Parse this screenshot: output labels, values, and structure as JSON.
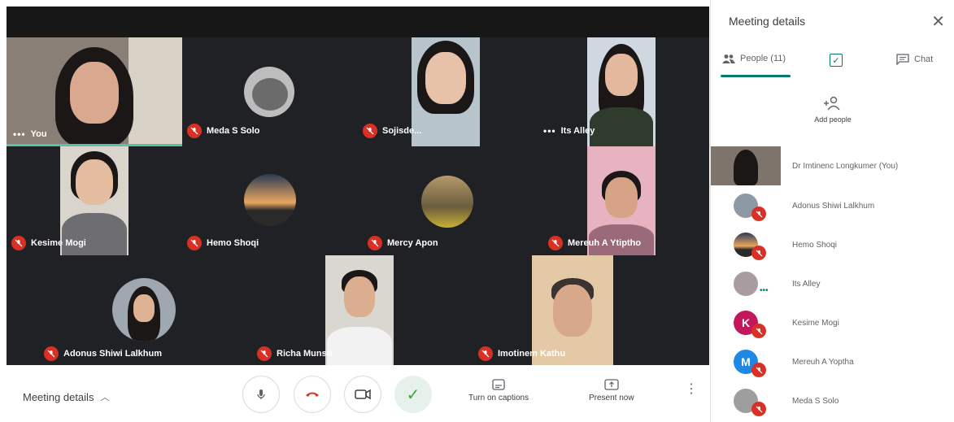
{
  "grid": {
    "tiles": [
      {
        "name": "You",
        "muted": false,
        "more": true
      },
      {
        "name": "Meda S Solo",
        "muted": true
      },
      {
        "name": "Sojisde...",
        "muted": true
      },
      {
        "name": "Its Alley",
        "muted": false,
        "more": true
      },
      {
        "name": "Kesime Mogi",
        "muted": true
      },
      {
        "name": "Hemo Shoqi",
        "muted": true
      },
      {
        "name": "Mercy Apon",
        "muted": true
      },
      {
        "name": "Mereuh A Ytiptho",
        "muted": true
      },
      {
        "name": "Adonus Shiwi Lalkhum",
        "muted": true
      },
      {
        "name": "Richa Munsti",
        "muted": true
      },
      {
        "name": "Imotinem Kathu",
        "muted": true
      }
    ]
  },
  "controls": {
    "meeting_details": "Meeting details",
    "captions": "Turn on captions",
    "present": "Present now"
  },
  "panel": {
    "title": "Meeting details",
    "tabs": {
      "people": "People (11)",
      "chat": "Chat"
    },
    "add_people": "Add people",
    "people": [
      {
        "name": "Dr Imtinenc Longkumer (You)"
      },
      {
        "name": "Adonus Shiwi Lalkhum"
      },
      {
        "name": "Hemo Shoqi"
      },
      {
        "name": "Its Alley"
      },
      {
        "name": "Kesime Mogi",
        "initial": "K"
      },
      {
        "name": "Mereuh A Yoptha",
        "initial": "M"
      },
      {
        "name": "Meda S Solo"
      }
    ]
  },
  "colors": {
    "accent": "#00796b",
    "muted_red": "#d93025",
    "avatar_k": "#c2185b",
    "avatar_m": "#1e88e5"
  }
}
